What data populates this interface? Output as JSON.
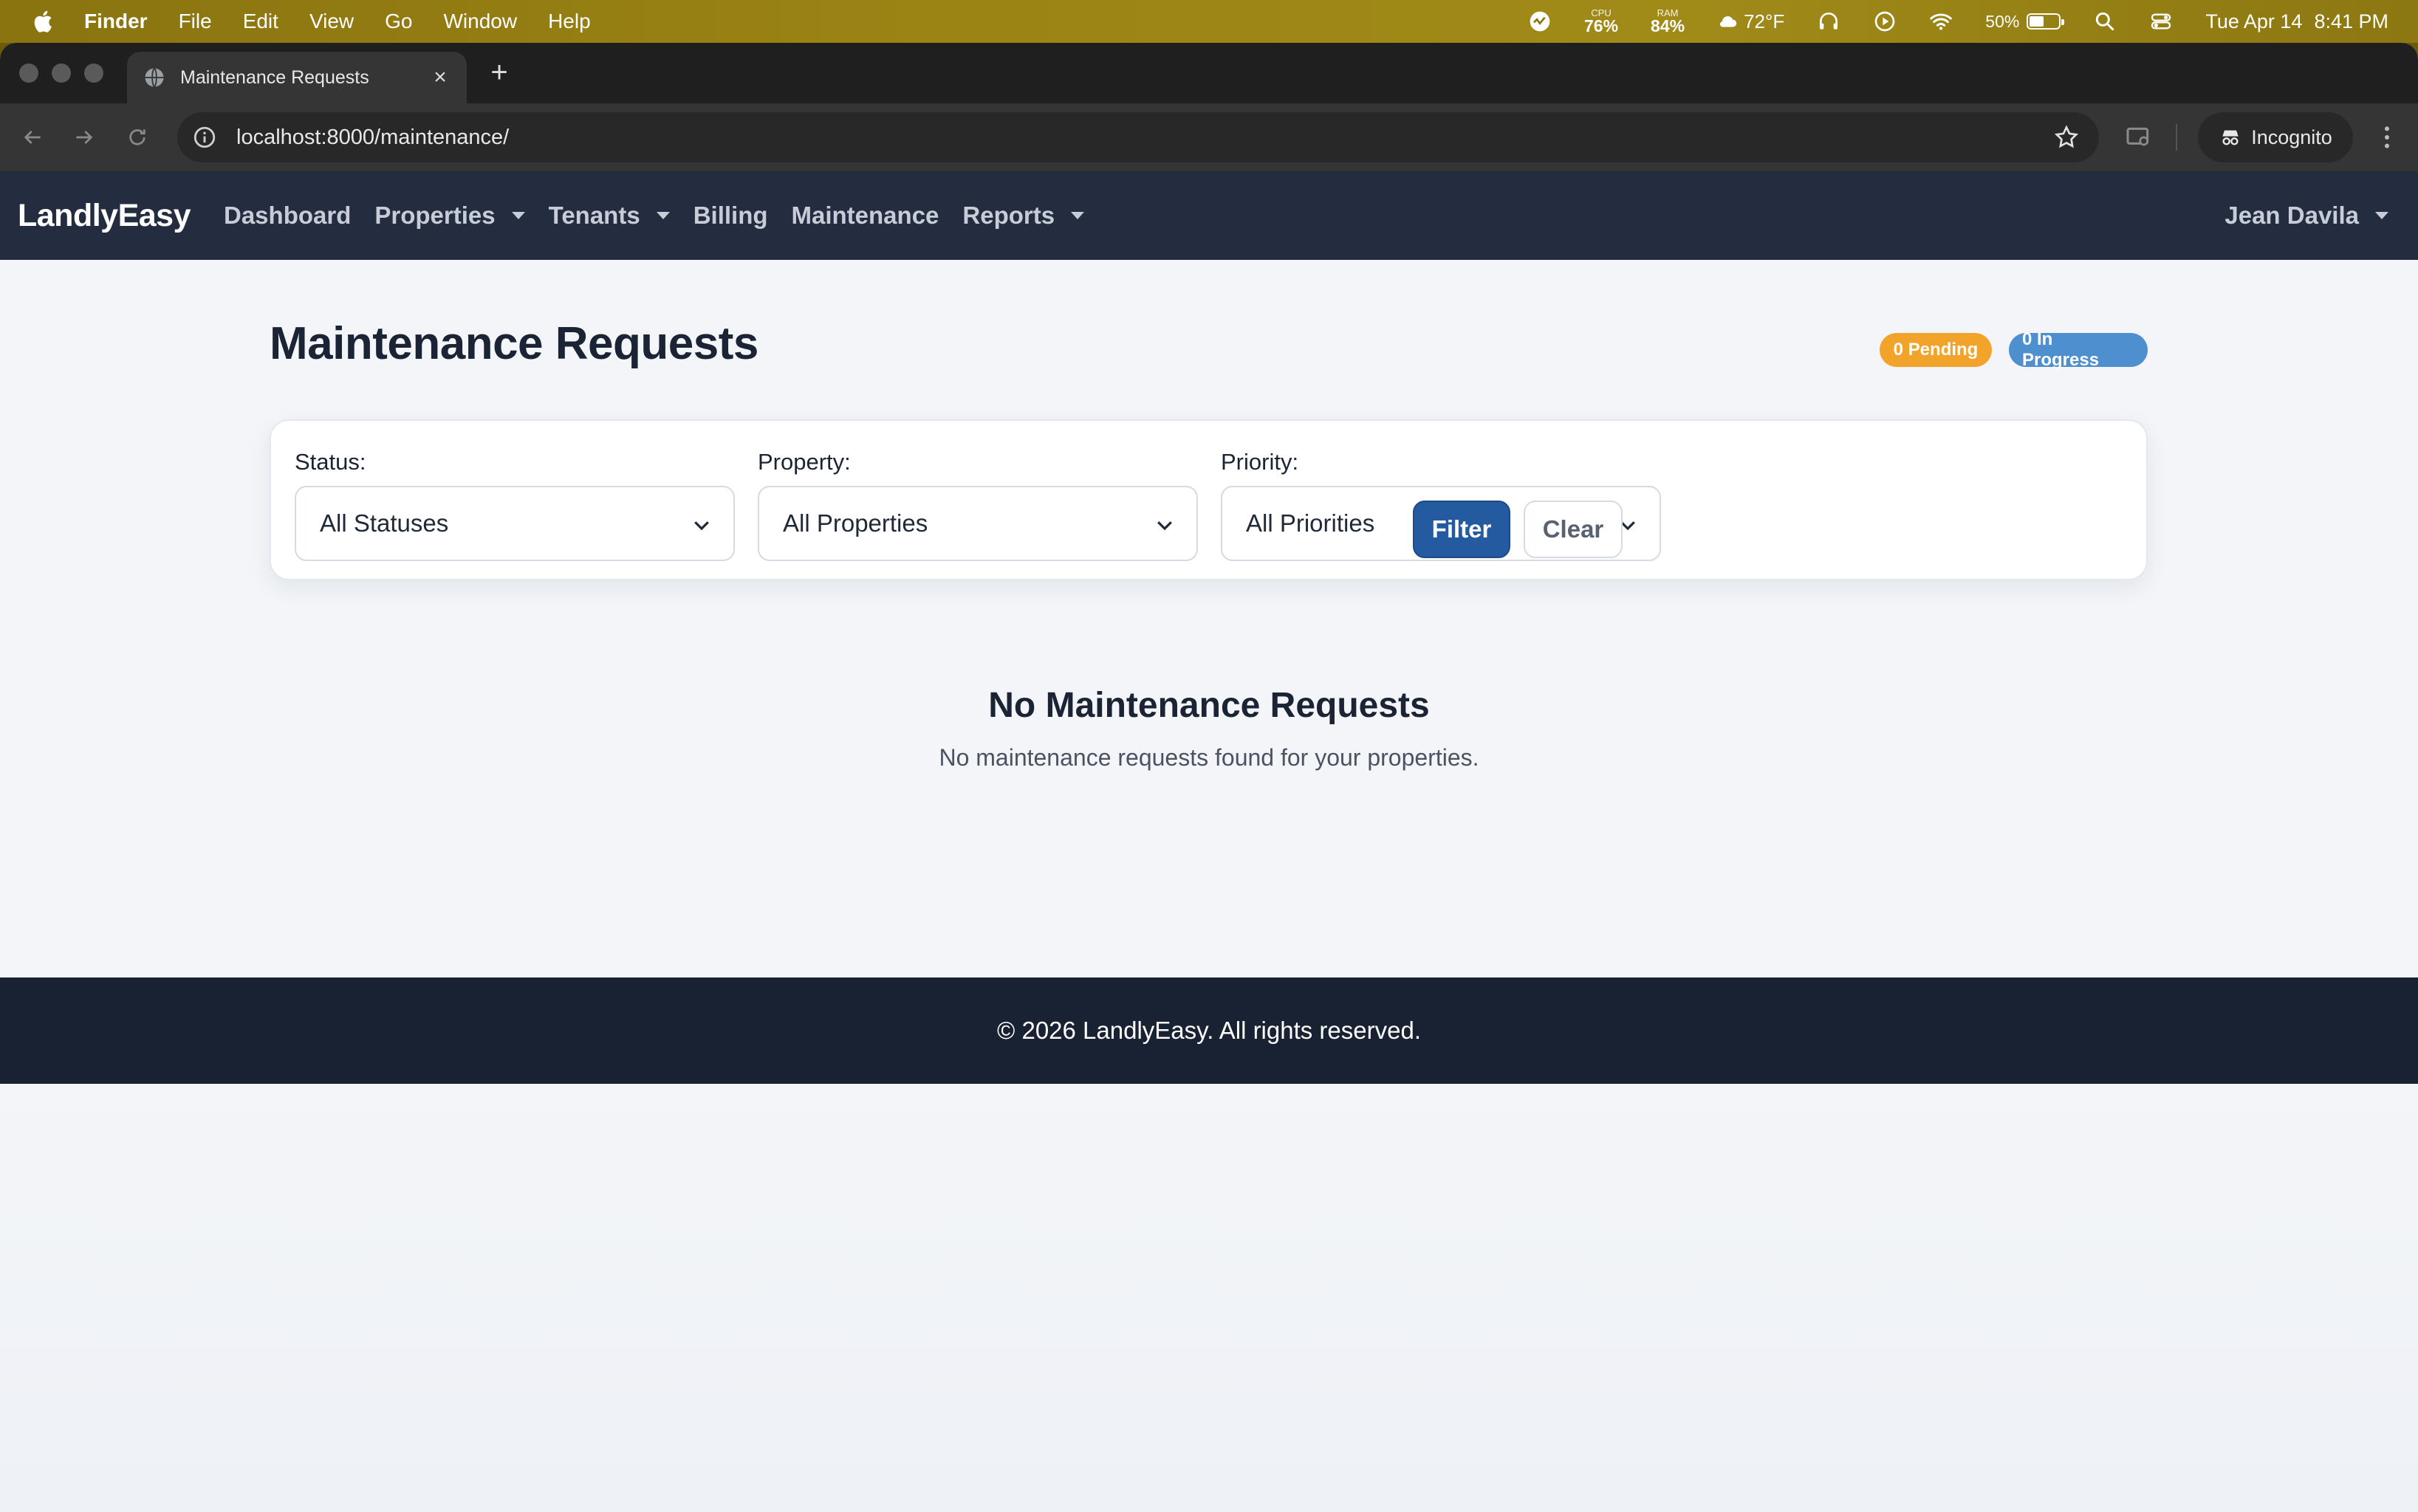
{
  "menubar": {
    "app_name": "Finder",
    "menus": [
      "File",
      "Edit",
      "View",
      "Go",
      "Window",
      "Help"
    ],
    "cpu": {
      "label": "CPU",
      "value": "76%"
    },
    "ram": {
      "label": "RAM",
      "value": "84%"
    },
    "weather": "72°F",
    "battery": {
      "percent_text": "50%",
      "level": 0.5
    },
    "date": "Tue Apr 14",
    "time": "8:41 PM"
  },
  "browser": {
    "tab_title": "Maintenance Requests",
    "url": "localhost:8000/maintenance/",
    "profile": "Incognito"
  },
  "app": {
    "brand": "LandlyEasy",
    "nav": [
      {
        "label": "Dashboard",
        "dropdown": false
      },
      {
        "label": "Properties",
        "dropdown": true
      },
      {
        "label": "Tenants",
        "dropdown": true
      },
      {
        "label": "Billing",
        "dropdown": false
      },
      {
        "label": "Maintenance",
        "dropdown": false
      },
      {
        "label": "Reports",
        "dropdown": true
      }
    ],
    "user": "Jean Davila"
  },
  "page": {
    "title": "Maintenance Requests",
    "badges": {
      "pending": "0 Pending",
      "in_progress": "0 In Progress"
    },
    "filters": {
      "status": {
        "label": "Status:",
        "value": "All Statuses"
      },
      "property": {
        "label": "Property:",
        "value": "All Properties"
      },
      "priority": {
        "label": "Priority:",
        "value": "All Priorities"
      },
      "filter_button": "Filter",
      "clear_button": "Clear"
    },
    "empty": {
      "title": "No Maintenance Requests",
      "subtitle": "No maintenance requests found for your properties."
    }
  },
  "footer": {
    "text": "© 2026 LandlyEasy. All rights reserved."
  },
  "colors": {
    "nav_bg": "#232d3f",
    "footer_bg": "#182232",
    "primary": "#235aa0",
    "pending": "#f2a42a",
    "in_progress": "#4d8fcf"
  }
}
